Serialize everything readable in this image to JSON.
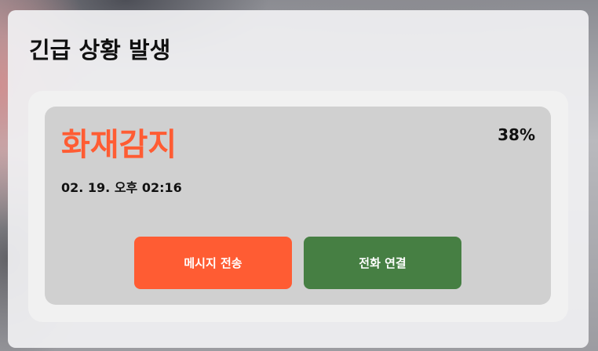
{
  "modal": {
    "title": "긴급 상황 발생"
  },
  "alert": {
    "title": "화재감지",
    "timestamp": "02. 19. 오후 02:16",
    "percent": "38%"
  },
  "actions": {
    "send_message_label": "메시지 전송",
    "connect_call_label": "전화 연결"
  },
  "colors": {
    "alert_title": "#ff5c33",
    "send_message_button": "#ff5c33",
    "connect_call_button": "#467f43"
  }
}
